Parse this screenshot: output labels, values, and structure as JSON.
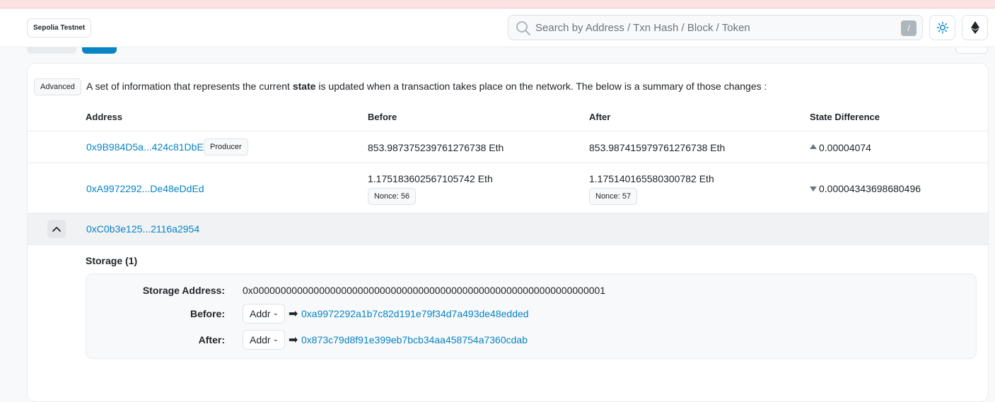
{
  "header": {
    "network_badge": "Sepolia Testnet",
    "search_placeholder": "Search by Address / Txn Hash / Block / Token",
    "search_shortcut": "/"
  },
  "state_card": {
    "advanced_badge": "Advanced",
    "intro_prefix": "A set of information that represents the current ",
    "intro_bold": "state",
    "intro_suffix": " is updated when a transaction takes place on the network. The below is a summary of those changes :",
    "columns": [
      "Address",
      "Before",
      "After",
      "State Difference"
    ],
    "rows": [
      {
        "address": "0x9B984D5a...424c81DbE",
        "tag": "Producer",
        "before": "853.987375239761276738 Eth",
        "after": "853.987415979761276738 Eth",
        "diff_dir": "up",
        "diff": "0.00004074"
      },
      {
        "address": "0xA9972292...De48eDdEd",
        "before": "1.175183602567105742 Eth",
        "before_nonce": "Nonce: 56",
        "after": "1.175140165580300782 Eth",
        "after_nonce": "Nonce: 57",
        "diff_dir": "down",
        "diff": "0.00004343698680496"
      },
      {
        "address": "0xC0b3e125...2116a2954",
        "expanded": true
      }
    ],
    "storage": {
      "title": "Storage (1)",
      "address_label": "Storage Address:",
      "address_value": "0x0000000000000000000000000000000000000000000000000000000000000001",
      "before_label": "Before:",
      "before_format": "Addr",
      "before_value": "0xa9972292a1b7c82d191e79f34d7a493de48edded",
      "after_label": "After:",
      "after_format": "Addr",
      "after_value": "0x873c79d8f91e399eb7bcb34aa458754a7360cdab"
    }
  },
  "colors": {
    "link": "#0784c3",
    "top_strip": "#fde2e4"
  },
  "icons": [
    "search-icon",
    "sun-icon",
    "ethereum-icon",
    "chevron-up-icon",
    "caret-up-icon",
    "caret-down-icon",
    "chevron-down-icon",
    "right-arrow-icon"
  ]
}
